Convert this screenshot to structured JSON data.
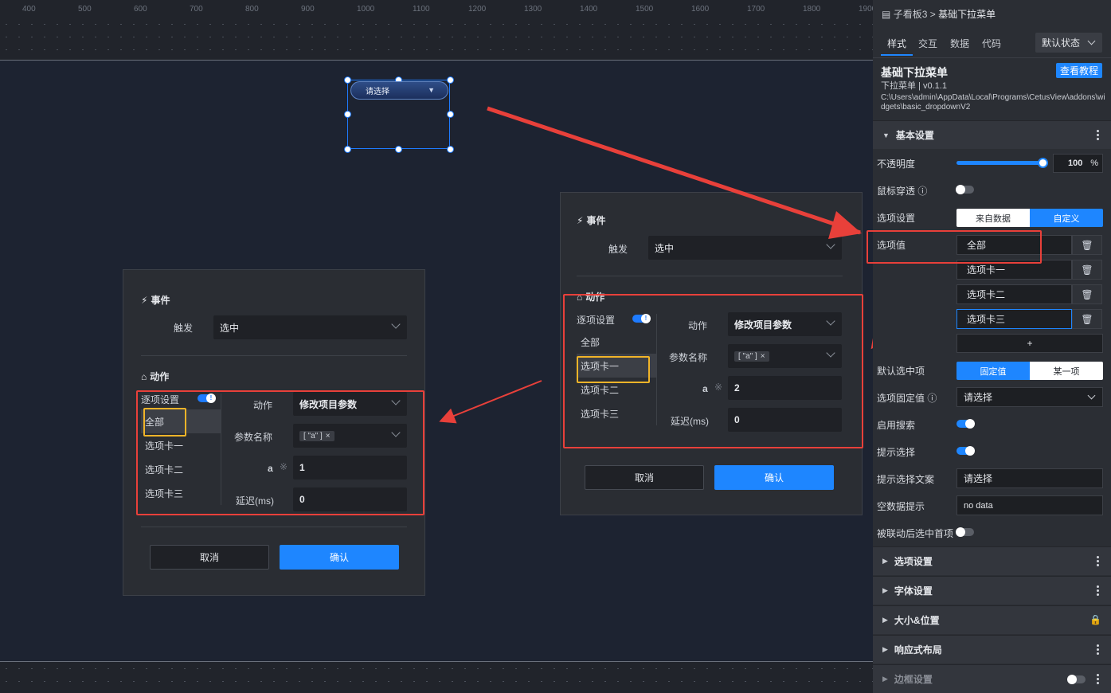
{
  "ruler": {
    "ticks": [
      "400",
      "500",
      "600",
      "700",
      "800",
      "900",
      "1000",
      "1100",
      "1200",
      "1300",
      "1400",
      "1500",
      "1600",
      "1700",
      "1800",
      "1900"
    ]
  },
  "widget": {
    "placeholder": "请选择",
    "caret": "▼"
  },
  "dialog_left": {
    "event_title": "事件",
    "trigger_label": "触发",
    "trigger_value": "选中",
    "action_title": "动作",
    "per_item_label": "逐项设置",
    "items": [
      "全部",
      "选项卡一",
      "选项卡二",
      "选项卡三"
    ],
    "action_label": "动作",
    "action_value": "修改项目参数",
    "param_label": "参数名称",
    "param_tag": "[ \"a\" ]",
    "tag_close": "×",
    "a_label": "a",
    "a_value": "1",
    "delay_label": "延迟(ms)",
    "delay_value": "0",
    "cancel": "取消",
    "confirm": "确认"
  },
  "dialog_right": {
    "event_title": "事件",
    "trigger_label": "触发",
    "trigger_value": "选中",
    "action_title": "动作",
    "per_item_label": "逐项设置",
    "items": [
      "全部",
      "选项卡一",
      "选项卡二",
      "选项卡三"
    ],
    "action_label": "动作",
    "action_value": "修改项目参数",
    "param_label": "参数名称",
    "param_tag": "[ \"a\" ]",
    "tag_close": "×",
    "a_label": "a",
    "a_value": "2",
    "delay_label": "延迟(ms)",
    "delay_value": "0",
    "cancel": "取消",
    "confirm": "确认"
  },
  "panel": {
    "breadcrumb_parent": "子看板3",
    "breadcrumb_sep": ">",
    "breadcrumb_current": "基础下拉菜单",
    "tabs": [
      "样式",
      "交互",
      "数据",
      "代码"
    ],
    "state_select": "默认状态",
    "component_name": "基础下拉菜单",
    "tutorial_button": "查看教程",
    "component_type": "下拉菜单 | v0.1.1",
    "component_path": "C:\\Users\\admin\\AppData\\Local\\Programs\\CetusView\\addons\\widgets\\basic_dropdownV2",
    "basic_section": "基本设置",
    "opacity_label": "不透明度",
    "opacity_value": "100",
    "opacity_unit": "%",
    "opacity_level": 1.0,
    "mouse_through_label": "鼠标穿透",
    "option_settings_label": "选项设置",
    "option_from_data": "来自数据",
    "option_custom": "自定义",
    "option_values_label": "选项值",
    "option_values": [
      "全部",
      "选项卡一",
      "选项卡二",
      "选项卡三"
    ],
    "add_button": "+",
    "default_selected_label": "默认选中项",
    "default_fixed": "固定值",
    "default_one": "某一项",
    "fixed_value_label": "选项固定值",
    "fixed_value_placeholder": "请选择",
    "enable_search_label": "启用搜索",
    "hint_select_label": "提示选择",
    "hint_text_label": "提示选择文案",
    "hint_text_value": "请选择",
    "empty_hint_label": "空数据提示",
    "empty_hint_value": "no data",
    "linked_first_label": "被联动后选中首项",
    "sections": [
      "选项设置",
      "字体设置",
      "大小&位置",
      "响应式布局",
      "边框设置"
    ]
  },
  "colors": {
    "accent": "#1e86ff",
    "annotation_red": "#e8403a",
    "annotation_yellow": "#f0b429"
  }
}
